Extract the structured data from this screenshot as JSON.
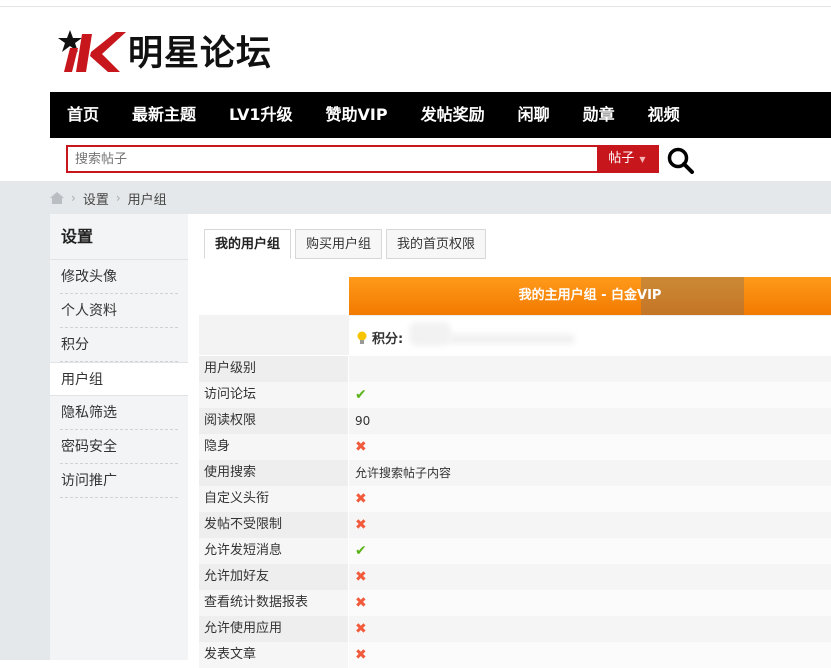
{
  "header": {
    "logo_text": "明星论坛",
    "logo_mark": "iK"
  },
  "nav": [
    "首页",
    "最新主题",
    "LV1升级",
    "赞助VIP",
    "发帖奖励",
    "闲聊",
    "勋章",
    "视频"
  ],
  "search": {
    "placeholder": "搜索帖子",
    "type": "帖子"
  },
  "breadcrumb": {
    "items": [
      "设置",
      "用户组"
    ]
  },
  "sidebar": {
    "title": "设置",
    "items": [
      "修改头像",
      "个人资料",
      "积分",
      "用户组",
      "隐私筛选",
      "密码安全",
      "访问推广"
    ],
    "active": "用户组"
  },
  "tabs": [
    "我的用户组",
    "购买用户组",
    "我的首页权限"
  ],
  "group": {
    "title": "我的主用户组 - 白金VIP",
    "points_label": "积分:"
  },
  "rows": [
    {
      "k": "用户级别",
      "v": ""
    },
    {
      "k": "访问论坛",
      "v": "✔",
      "t": "yes"
    },
    {
      "k": "阅读权限",
      "v": "90"
    },
    {
      "k": "隐身",
      "v": "✖",
      "t": "no"
    },
    {
      "k": "使用搜索",
      "v": "允许搜索帖子内容"
    },
    {
      "k": "自定义头衔",
      "v": "✖",
      "t": "no"
    },
    {
      "k": "发帖不受限制",
      "v": "✖",
      "t": "no"
    },
    {
      "k": "允许发短消息",
      "v": "✔",
      "t": "yes"
    },
    {
      "k": "允许加好友",
      "v": "✖",
      "t": "no"
    },
    {
      "k": "查看统计数据报表",
      "v": "✖",
      "t": "no"
    },
    {
      "k": "允许使用应用",
      "v": "✖",
      "t": "no"
    },
    {
      "k": "发表文章",
      "v": "✖",
      "t": "no"
    }
  ],
  "colors": {
    "brand_red": "#c8161d",
    "nav_bg": "#000000",
    "group_orange": "#f5850d",
    "yes": "#5bb31a",
    "no": "#f25a3b"
  },
  "icons": [
    "star-icon",
    "search-icon",
    "home-icon",
    "bulb-icon",
    "check-icon",
    "cross-icon",
    "caret-down-icon"
  ]
}
